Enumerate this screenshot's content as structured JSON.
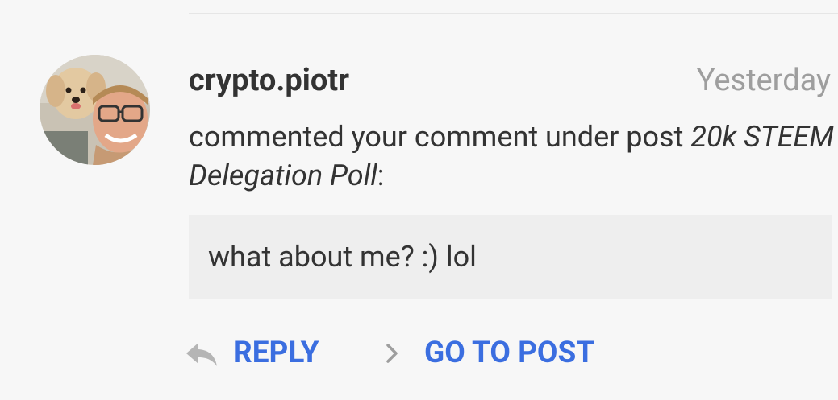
{
  "notification": {
    "username": "crypto.piotr",
    "timestamp": "Yesterday",
    "message_prefix": "commented your comment under post ",
    "post_title": "20k STEEM Delegation Poll",
    "message_suffix": ":",
    "comment_text": "what about me? :) lol"
  },
  "actions": {
    "reply_label": "REPLY",
    "goto_label": "GO TO POST"
  },
  "icons": {
    "reply": "reply-arrow-icon",
    "goto": "chevron-right-icon"
  },
  "colors": {
    "background": "#f7f7f7",
    "accent": "#3b6ee0",
    "text": "#333333",
    "muted": "#9e9e9e",
    "quote_bg": "#eeeeee",
    "icon_gray": "#b5b5b5"
  }
}
